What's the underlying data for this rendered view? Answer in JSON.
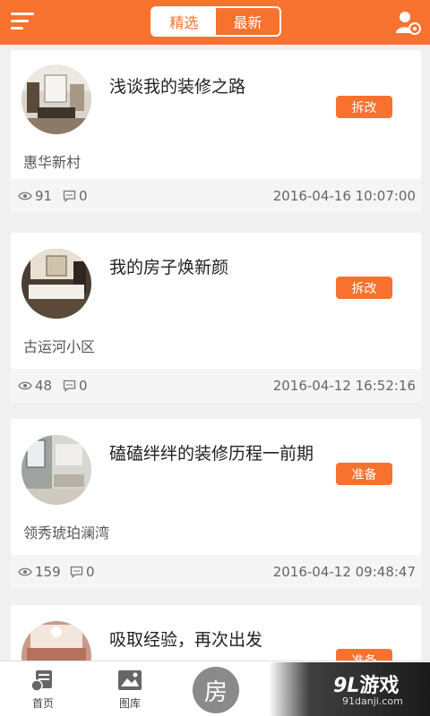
{
  "header": {
    "tabs": [
      {
        "label": "精选",
        "active": true
      },
      {
        "label": "最新",
        "active": false
      }
    ]
  },
  "posts": [
    {
      "title": "浅谈我的装修之路",
      "tag": "拆改",
      "location": "惠华新村",
      "views": "91",
      "comments": "0",
      "date": "2016-04-16 10:07:00"
    },
    {
      "title": "我的房子焕新颜",
      "tag": "拆改",
      "location": "古运河小区",
      "views": "48",
      "comments": "0",
      "date": "2016-04-12 16:52:16"
    },
    {
      "title": "磕磕绊绊的装修历程一前期",
      "tag": "准备",
      "location": "领秀琥珀澜湾",
      "views": "159",
      "comments": "0",
      "date": "2016-04-12 09:48:47"
    },
    {
      "title": "吸取经验，再次出发",
      "tag": "准备",
      "location": "",
      "views": "",
      "comments": "",
      "date": ""
    }
  ],
  "bottom_nav": {
    "home": "首页",
    "gallery": "图库",
    "center": "房"
  },
  "watermark": {
    "logo_num": "9L",
    "logo_text": "游戏",
    "url": "91danji.com"
  },
  "colors": {
    "accent": "#f7712f"
  }
}
